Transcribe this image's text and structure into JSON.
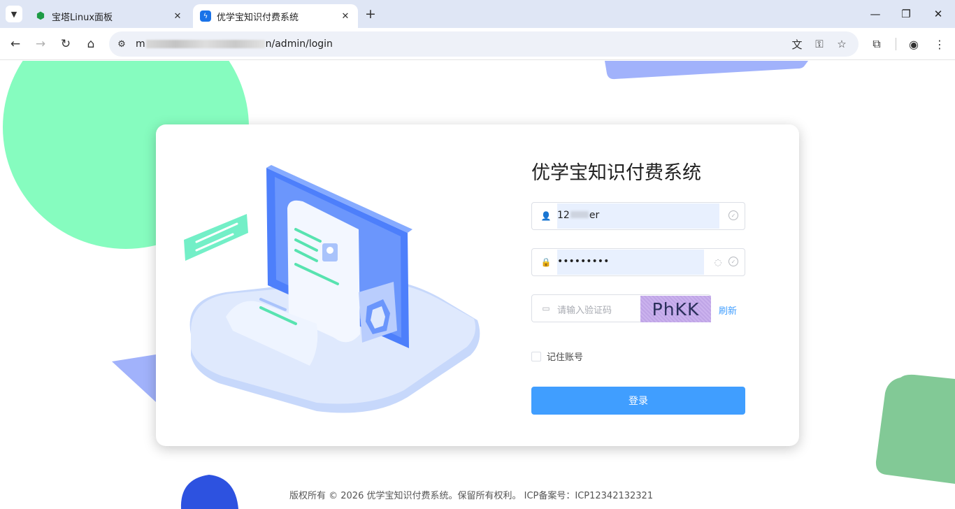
{
  "browser": {
    "tabs": [
      {
        "title": "宝塔Linux面板",
        "active": false,
        "favicon": "shield-icon"
      },
      {
        "title": "优学宝知识付费系统",
        "active": true,
        "favicon": "lightning-icon"
      }
    ],
    "url_start": "m",
    "url_end": "n/admin/login"
  },
  "login": {
    "system_title": "优学宝知识付费系统",
    "username_value": "12",
    "username_value_end": "er",
    "password_value": "•••••••••",
    "captcha_placeholder": "请输入验证码",
    "captcha_text": "PhKK",
    "refresh_label": "刷新",
    "remember_label": "记住账号",
    "login_button": "登录"
  },
  "footer": {
    "text": "版权所有 © 2026 优学宝知识付费系统。保留所有权利。 ICP备案号：ICP12342132321"
  },
  "colors": {
    "accent": "#409eff",
    "deco_green": "#86fcbf",
    "deco_blue": "#a1b2fb",
    "deco_dark_green": "#82c996",
    "deco_dark_blue": "#2d52e0"
  }
}
